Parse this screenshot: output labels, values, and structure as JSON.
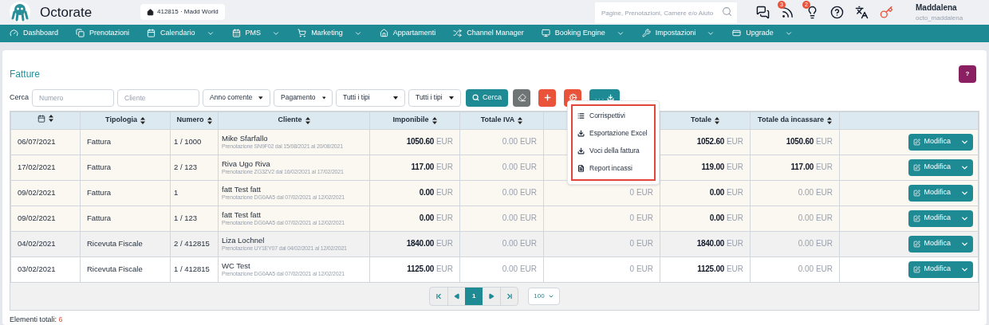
{
  "header": {
    "brand": "Octorate",
    "property": "412815 · Madd World",
    "search": {
      "placeholder": "Pagine, Prenotazioni, Camere e/o Aiuto"
    },
    "icons": [
      {
        "kind": "chat"
      },
      {
        "kind": "feed",
        "badge": "3"
      },
      {
        "kind": "bulb",
        "badge": "2"
      },
      {
        "kind": "help"
      },
      {
        "kind": "translate"
      },
      {
        "kind": "key"
      }
    ],
    "user": {
      "name": "Maddalena",
      "username": "octo_maddalena"
    }
  },
  "nav": [
    {
      "kind": "dashboard",
      "label": "Dashboard",
      "dropdown": false
    },
    {
      "kind": "bookings",
      "label": "Prenotazioni",
      "dropdown": false
    },
    {
      "kind": "calendar",
      "label": "Calendario",
      "dropdown": true
    },
    {
      "kind": "pms",
      "label": "PMS",
      "dropdown": true
    },
    {
      "kind": "cart",
      "label": "Marketing",
      "dropdown": true
    },
    {
      "kind": "home",
      "label": "Appartamenti",
      "dropdown": false
    },
    {
      "kind": "shuffle",
      "label": "Channel Manager",
      "dropdown": false
    },
    {
      "kind": "monitor",
      "label": "Booking Engine",
      "dropdown": true
    },
    {
      "kind": "wrench",
      "label": "Impostazioni",
      "dropdown": true
    },
    {
      "kind": "card",
      "label": "Upgrade",
      "dropdown": true
    }
  ],
  "page": {
    "title": "Fatture",
    "help": "?"
  },
  "filters": {
    "label": "Cerca",
    "inputs": [
      {
        "placeholder": "Numero"
      },
      {
        "placeholder": "Cliente"
      }
    ],
    "selects": [
      "Anno corrente",
      "Pagamento",
      "Tutti i tipi",
      "Tutti i tipi"
    ],
    "buttons": [
      {
        "kind": "search",
        "label": "Cerca"
      },
      {
        "kind": "eraser"
      },
      {
        "kind": "plus"
      },
      {
        "kind": "cogs"
      },
      {
        "kind": "export",
        "label": ". . ."
      }
    ]
  },
  "export_menu": [
    {
      "kind": "list",
      "label": "Corrispettivi"
    },
    {
      "kind": "download",
      "label": "Esportazione Excel"
    },
    {
      "kind": "download",
      "label": "Voci della fattura"
    },
    {
      "kind": "file",
      "label": "Report incassi"
    }
  ],
  "table": {
    "columns": [
      {
        "kind": "date"
      },
      {
        "label": "Tipologia"
      },
      {
        "label": "Numero"
      },
      {
        "label": "Cliente"
      },
      {
        "label": "Imponibile"
      },
      {
        "label": "Totale IVA"
      },
      {
        "kind": "hidden"
      },
      {
        "label": "Totale"
      },
      {
        "label": "Totale da incassare"
      },
      {
        "kind": "actions"
      }
    ],
    "rows": [
      {
        "color": "#fbf8f1",
        "date": "06/07/2021",
        "type": "Fattura",
        "number": "1 / 1000",
        "client": "Mike Sfarfallo",
        "booking": "Prenotazione SN9F02 dal 15/08/2021 al 20/08/2021",
        "imponibile": {
          "amount": "1050.60",
          "currency": "EUR",
          "muted": false
        },
        "iva": {
          "amount": "0.00",
          "currency": "EUR",
          "muted": true
        },
        "totale": {
          "amount": "1052.60",
          "currency": "EUR",
          "muted": false
        },
        "incassare": {
          "amount": "1050.60",
          "currency": "EUR",
          "muted": false
        },
        "action": "Modifica"
      },
      {
        "color": "#fbf8f1",
        "date": "17/02/2021",
        "type": "Fattura",
        "number": "2 / 123",
        "client": "Riva Ugo Riva",
        "booking": "Prenotazione ZG3ZV2 dal 16/02/2021 al 17/02/2021",
        "imponibile": {
          "amount": "117.00",
          "currency": "EUR",
          "muted": false
        },
        "iva": {
          "amount": "0.00",
          "currency": "EUR",
          "muted": true
        },
        "totale": {
          "amount": "119.00",
          "currency": "EUR",
          "muted": false
        },
        "incassare": {
          "amount": "117.00",
          "currency": "EUR",
          "muted": false
        },
        "action": "Modifica"
      },
      {
        "color": "#fbf8f1",
        "date": "09/02/2021",
        "type": "Fattura",
        "number": "1",
        "client": "fatt Test fatt",
        "booking": "Prenotazione DG0AA5 dal 07/02/2021 al 12/02/2021",
        "imponibile": {
          "amount": "0.00",
          "currency": "EUR",
          "muted": false
        },
        "iva": {
          "amount": "0.00",
          "currency": "EUR",
          "muted": true
        },
        "column_7": {
          "amount": "0",
          "currency": "EUR",
          "muted": true
        },
        "totale": {
          "amount": "0.00",
          "currency": "EUR",
          "muted": false
        },
        "incassare": {
          "amount": "0.00",
          "currency": "EUR",
          "muted": true
        },
        "action": "Modifica"
      },
      {
        "color": "#fbf8f1",
        "date": "09/02/2021",
        "type": "Fattura",
        "number": "1 / 123",
        "client": "fatt Test fatt",
        "booking": "Prenotazione DG0AA5 dal 07/02/2021 al 12/02/2021",
        "imponibile": {
          "amount": "0.00",
          "currency": "EUR",
          "muted": false
        },
        "iva": {
          "amount": "0.00",
          "currency": "EUR",
          "muted": true
        },
        "column_7": {
          "amount": "0",
          "currency": "EUR",
          "muted": true
        },
        "totale": {
          "amount": "0.00",
          "currency": "EUR",
          "muted": false
        },
        "incassare": {
          "amount": "0.00",
          "currency": "EUR",
          "muted": true
        },
        "action": "Modifica"
      },
      {
        "color": "#f1f1f1",
        "date": "04/02/2021",
        "type": "Ricevuta Fiscale",
        "number": "2 / 412815",
        "client": "Liza Lochnel",
        "booking": "Prenotazione UY1EY07 dal 04/02/2021 al 12/02/2021",
        "imponibile": {
          "amount": "1840.00",
          "currency": "EUR",
          "muted": false
        },
        "iva": {
          "amount": "0.00",
          "currency": "EUR",
          "muted": true
        },
        "column_7": {
          "amount": "0",
          "currency": "EUR",
          "muted": true
        },
        "totale": {
          "amount": "1840.00",
          "currency": "EUR",
          "muted": false
        },
        "incassare": {
          "amount": "0.00",
          "currency": "EUR",
          "muted": true
        },
        "action": "Modifica"
      },
      {
        "color": "#ffffff",
        "date": "03/02/2021",
        "type": "Ricevuta Fiscale",
        "number": "1 / 412815",
        "client": "WC Test",
        "booking": "Prenotazione DG0AA5 dal 07/02/2021 al 12/02/2021",
        "imponibile": {
          "amount": "1125.00",
          "currency": "EUR",
          "muted": false
        },
        "iva": {
          "amount": "0.00",
          "currency": "EUR",
          "muted": true
        },
        "column_7": {
          "amount": "0",
          "currency": "EUR",
          "muted": true
        },
        "totale": {
          "amount": "1125.00",
          "currency": "EUR",
          "muted": false
        },
        "incassare": {
          "amount": "0.00",
          "currency": "EUR",
          "muted": true
        },
        "action": "Modifica"
      }
    ]
  },
  "pagination": {
    "pages": [
      {
        "label": "1",
        "selected": true
      }
    ],
    "page_size": "100"
  },
  "footer": {
    "label": "Elementi totali:",
    "count": "6"
  }
}
